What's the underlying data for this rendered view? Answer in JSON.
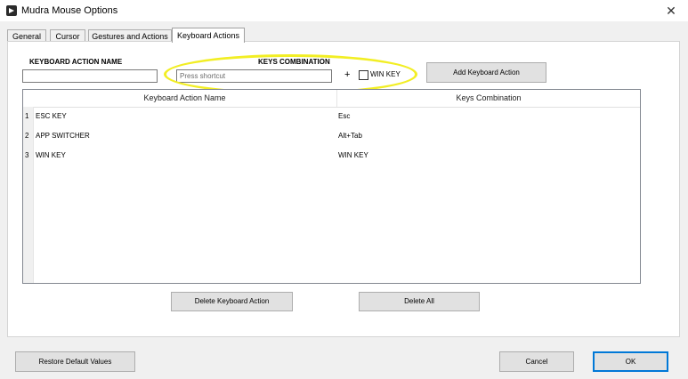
{
  "window": {
    "title": "Mudra Mouse Options",
    "close_glyph": "✕"
  },
  "tabs": [
    {
      "label": "General"
    },
    {
      "label": "Cursor"
    },
    {
      "label": "Gestures and Actions"
    },
    {
      "label": "Keyboard Actions"
    }
  ],
  "form": {
    "action_name_label": "KEYBOARD ACTION NAME",
    "keys_label": "KEYS COMBINATION",
    "shortcut_placeholder": "Press shortcut",
    "plus": "+",
    "win_key_label": "WIN KEY",
    "add_button": "Add Keyboard Action"
  },
  "table": {
    "headers": [
      "Keyboard Action Name",
      "Keys Combination"
    ],
    "rows": [
      {
        "num": "1",
        "name": "ESC KEY",
        "keys": "Esc"
      },
      {
        "num": "2",
        "name": "APP SWITCHER",
        "keys": "Alt+Tab"
      },
      {
        "num": "3",
        "name": "WIN KEY",
        "keys": "WIN KEY"
      }
    ]
  },
  "actions": {
    "delete_button": "Delete Keyboard Action",
    "delete_all_button": "Delete All"
  },
  "footer": {
    "restore_button": "Restore Default Values",
    "cancel_button": "Cancel",
    "ok_button": "OK"
  },
  "colors": {
    "highlight": "#f2ee24",
    "ok_border": "#0078d7"
  }
}
